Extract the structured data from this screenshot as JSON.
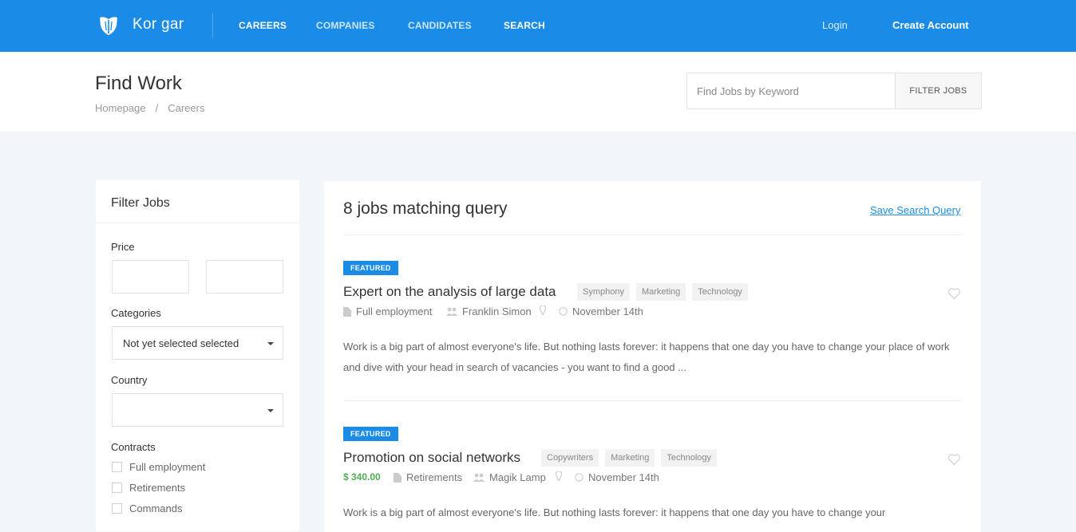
{
  "app": {
    "brand": "Kor gar",
    "colors": {
      "primary": "#1a8ce8",
      "price": "#4caf50",
      "background": "#f3f6f8"
    }
  },
  "nav": {
    "links": [
      "CAREERS",
      "COMPANIES",
      "CANDIDATES",
      "SEARCH"
    ],
    "login": "Login",
    "create_account": "Create Account"
  },
  "header": {
    "title": "Find Work",
    "breadcrumb": [
      "Homepage",
      "Careers"
    ],
    "breadcrumb_sep": "/",
    "search_placeholder": "Find Jobs by Keyword",
    "filter_button": "FILTER JOBS"
  },
  "sidebar": {
    "title": "Filter Jobs",
    "price_label": "Price",
    "categories_label": "Categories",
    "categories_value": "Not yet selected selected",
    "country_label": "Country",
    "country_value": "",
    "contracts_label": "Contracts",
    "contracts": [
      "Full employment",
      "Retirements",
      "Commands"
    ]
  },
  "results": {
    "title": "8 jobs matching query",
    "save_query": "Save Search Query",
    "jobs": [
      {
        "badge": "FEATURED",
        "title": "Expert on the analysis of large data",
        "tags": [
          "Symphony",
          "Marketing",
          "Technology"
        ],
        "price": "",
        "contract": "Full employment",
        "company": "Franklin Simon",
        "location": "",
        "date": "November 14th",
        "description": "Work is a big part of almost everyone's life. But nothing lasts forever: it happens that one day you have to change your place of work and dive with your head in search of vacancies - you want to find a good ..."
      },
      {
        "badge": "FEATURED",
        "title": "Promotion on social networks",
        "tags": [
          "Copywriters",
          "Marketing",
          "Technology"
        ],
        "price": "$ 340.00",
        "contract": "Retirements",
        "company": "Magik Lamp",
        "location": "",
        "date": "November 14th",
        "description": "Work is a big part of almost everyone's life. But nothing lasts forever: it happens that one day you have to change your"
      }
    ]
  },
  "icons": {
    "logo": "shield-logo-icon",
    "document": "document-icon",
    "company": "people-icon",
    "location": "map-pin-icon",
    "date": "clock-icon",
    "favorite": "heart-icon"
  }
}
